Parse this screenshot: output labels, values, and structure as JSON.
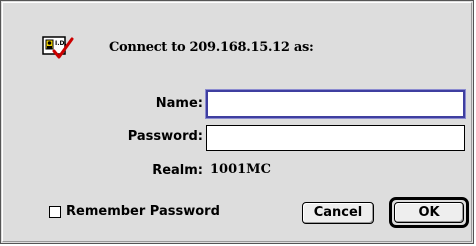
{
  "dialog": {
    "header": "Connect to  209.168.15.12  as:",
    "icon": "id-card-check-icon"
  },
  "form": {
    "name_label": "Name:",
    "name_value": "",
    "password_label": "Password:",
    "password_value": "",
    "realm_label": "Realm:",
    "realm_value": "1001MC"
  },
  "options": {
    "remember_password_label": "Remember Password",
    "remember_password_checked": false
  },
  "buttons": {
    "cancel_label": "Cancel",
    "ok_label": "OK"
  },
  "colors": {
    "dialog_bg": "#dddddd",
    "focus_border": "#3f3fa0",
    "check_red": "#cc0000",
    "id_card_yellow": "#f2d400"
  }
}
